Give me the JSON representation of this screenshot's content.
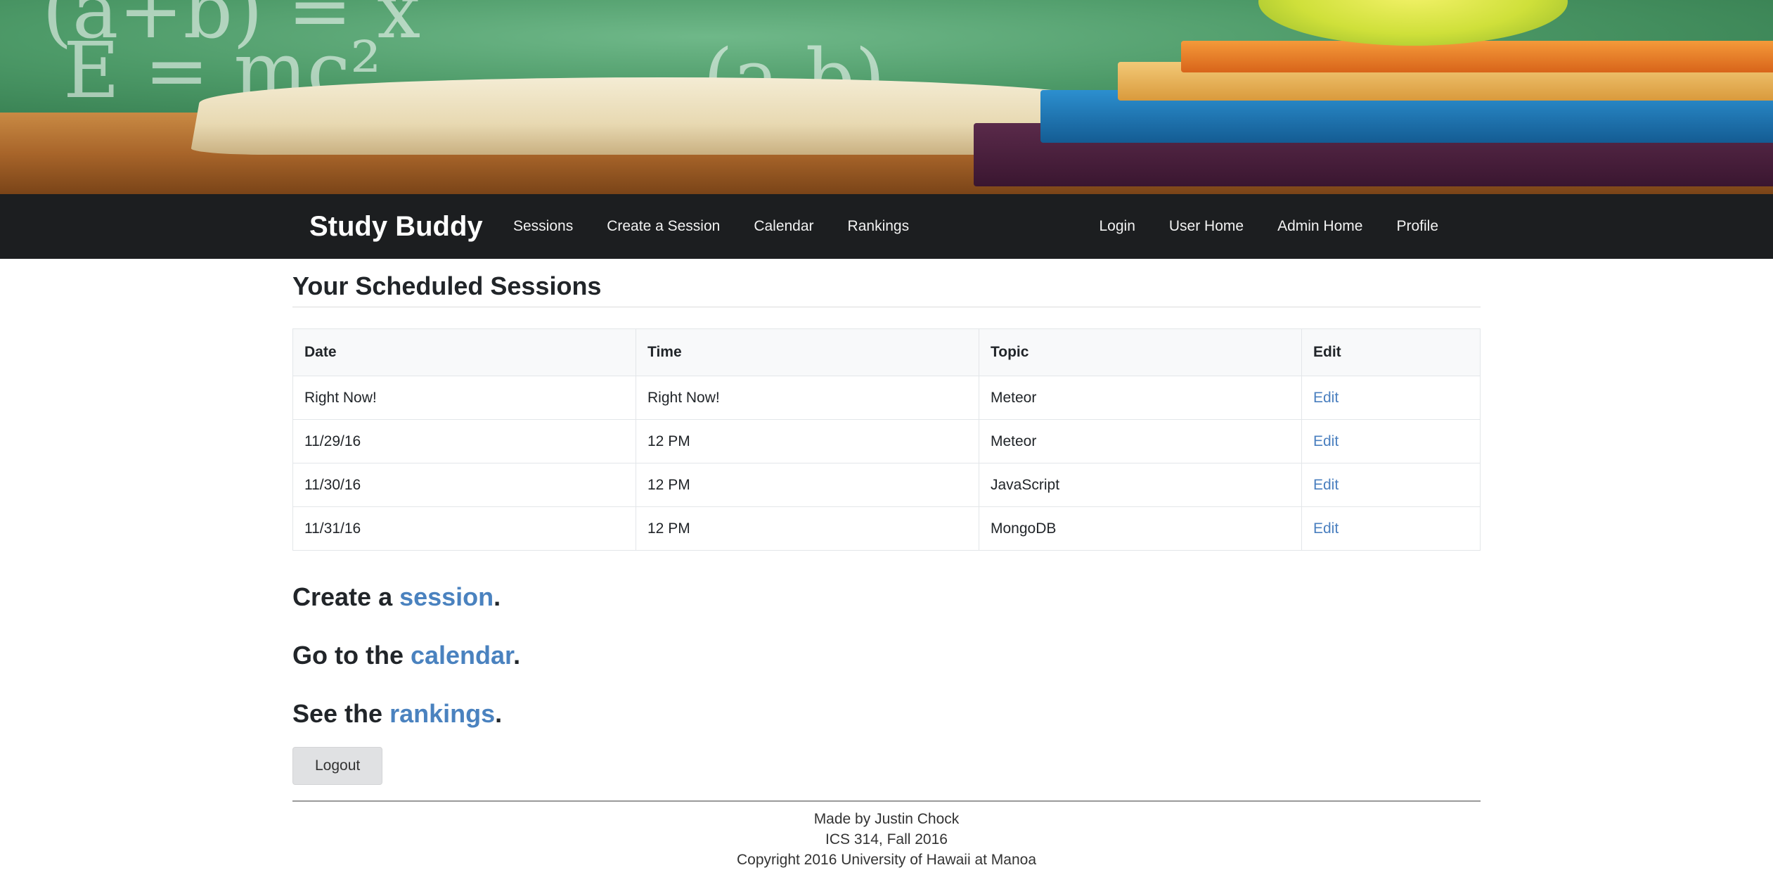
{
  "hero": {
    "chalk_1": "(a+b) = x",
    "chalk_2": "E = mc²",
    "chalk_3": "(a-b)"
  },
  "navbar": {
    "brand": "Study Buddy",
    "left_links": [
      "Sessions",
      "Create a Session",
      "Calendar",
      "Rankings"
    ],
    "right_links": [
      "Login",
      "User Home",
      "Admin Home",
      "Profile"
    ]
  },
  "main": {
    "title": "Your Scheduled Sessions",
    "table": {
      "headers": [
        "Date",
        "Time",
        "Topic",
        "Edit"
      ],
      "rows": [
        {
          "date": "Right Now!",
          "time": "Right Now!",
          "topic": "Meteor",
          "edit": "Edit"
        },
        {
          "date": "11/29/16",
          "time": "12 PM",
          "topic": "Meteor",
          "edit": "Edit"
        },
        {
          "date": "11/30/16",
          "time": "12 PM",
          "topic": "JavaScript",
          "edit": "Edit"
        },
        {
          "date": "11/31/16",
          "time": "12 PM",
          "topic": "MongoDB",
          "edit": "Edit"
        }
      ]
    },
    "cta": {
      "create_prefix": "Create a ",
      "create_link": "session",
      "calendar_prefix": "Go to the ",
      "calendar_link": "calendar",
      "rankings_prefix": "See the ",
      "rankings_link": "rankings",
      "suffix": "."
    },
    "logout_label": "Logout"
  },
  "footer": {
    "line1": "Made by Justin Chock",
    "line2": "ICS 314, Fall 2016",
    "line3": "Copyright 2016 University of Hawaii at Manoa"
  },
  "colors": {
    "navbar_bg": "#1c1e20",
    "link": "#4a82bf"
  }
}
